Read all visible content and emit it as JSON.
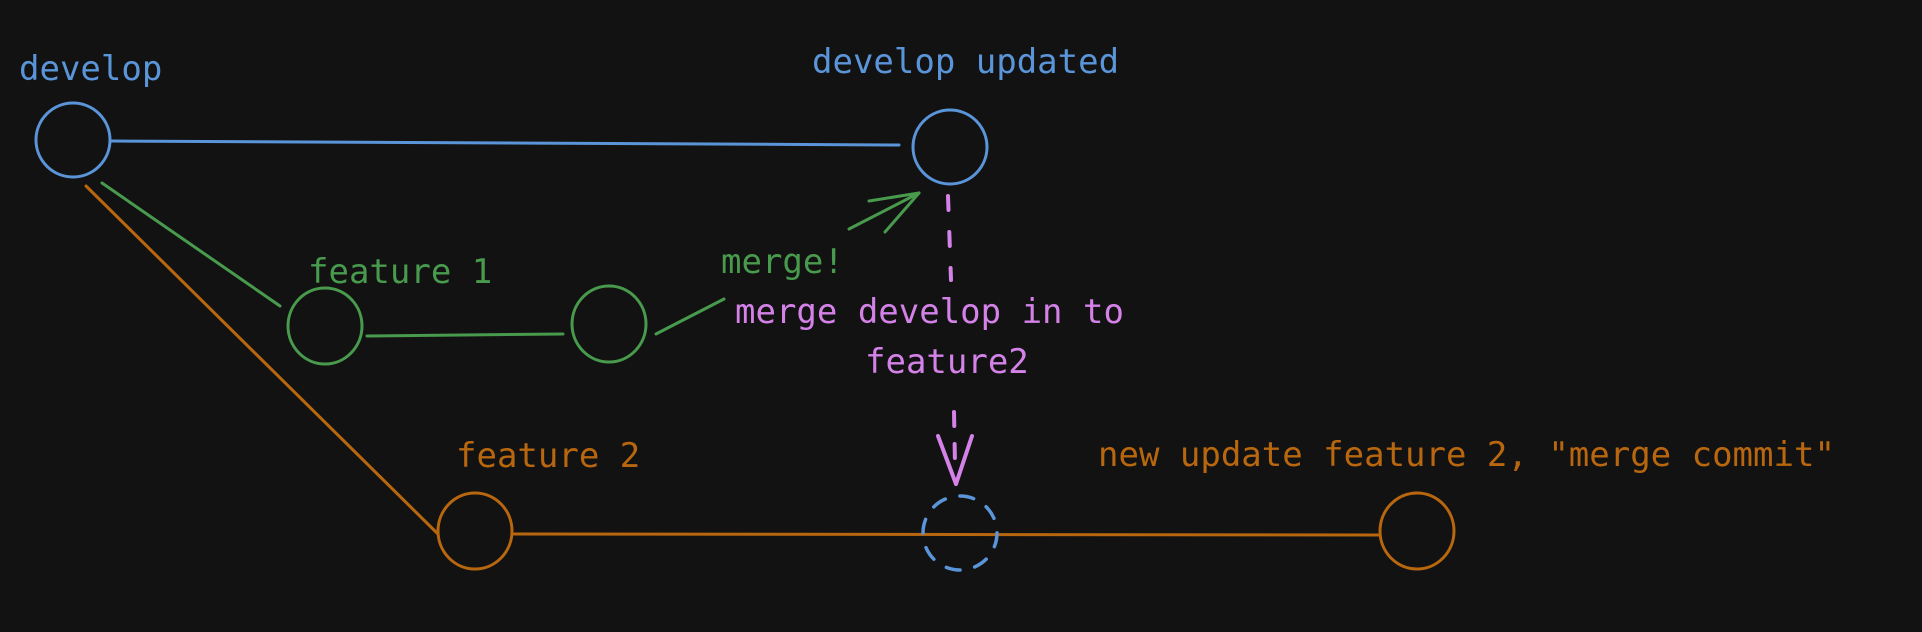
{
  "colors": {
    "background": "#121212",
    "develop": "#5b95d9",
    "feature1": "#489a4d",
    "feature2": "#b8670f",
    "annotation": "#d482e8"
  },
  "labels": {
    "develop": "develop",
    "develop_updated": "develop updated",
    "feature1": "feature 1",
    "feature2": "feature 2",
    "merge": "merge!",
    "merge_develop_line1": "merge develop in to",
    "merge_develop_line2": "feature2",
    "new_update": "new update feature 2, \"merge commit\""
  }
}
